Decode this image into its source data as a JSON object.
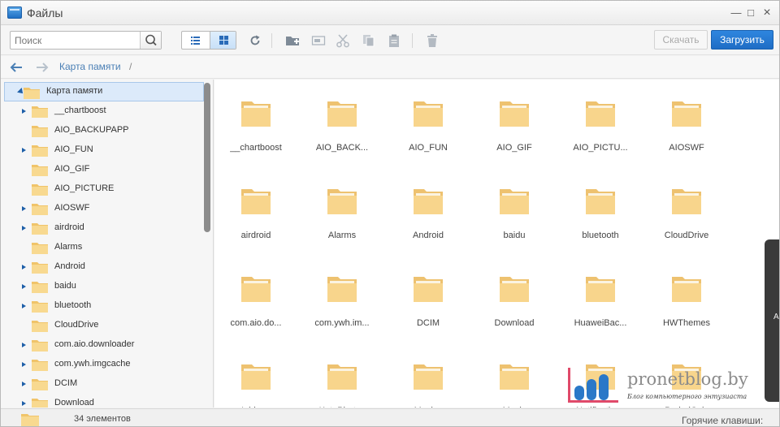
{
  "window": {
    "title": "Файлы",
    "controls": {
      "close": "×",
      "maximize": "□",
      "minimize": "—"
    }
  },
  "toolbar": {
    "search_placeholder": "Поиск",
    "secondary_button": "Скачать",
    "primary_button": "Загрузить",
    "icons": [
      "search-icon",
      "list-view-icon",
      "grid-view-icon",
      "refresh-icon",
      "new-folder-icon",
      "rename-icon",
      "cut-icon",
      "copy-icon",
      "paste-icon",
      "delete-icon"
    ]
  },
  "breadcrumb": {
    "path": "Карта памяти",
    "separator": "/"
  },
  "tree": {
    "root": "Карта памяти",
    "items": [
      {
        "label": "__chartboost",
        "expandable": true
      },
      {
        "label": "AIO_BACKUPAPP",
        "expandable": false
      },
      {
        "label": "AIO_FUN",
        "expandable": true
      },
      {
        "label": "AIO_GIF",
        "expandable": false
      },
      {
        "label": "AIO_PICTURE",
        "expandable": false
      },
      {
        "label": "AIOSWF",
        "expandable": true
      },
      {
        "label": "airdroid",
        "expandable": true
      },
      {
        "label": "Alarms",
        "expandable": false
      },
      {
        "label": "Android",
        "expandable": true
      },
      {
        "label": "baidu",
        "expandable": true
      },
      {
        "label": "bluetooth",
        "expandable": true
      },
      {
        "label": "CloudDrive",
        "expandable": false
      },
      {
        "label": "com.aio.downloader",
        "expandable": true
      },
      {
        "label": "com.ywh.imgcache",
        "expandable": true
      },
      {
        "label": "DCIM",
        "expandable": true
      },
      {
        "label": "Download",
        "expandable": true
      }
    ]
  },
  "grid": {
    "items": [
      "__chartboost",
      "AIO_BACK...",
      "AIO_FUN",
      "AIO_GIF",
      "AIO_PICTU...",
      "AIOSWF",
      "airdroid",
      "Alarms",
      "Android",
      "baidu",
      "bluetooth",
      "CloudDrive",
      "com.aio.do...",
      "com.ywh.im...",
      "DCIM",
      "Download",
      "HuaweiBac...",
      "HWThemes",
      "Iuidoon",
      "KatePhotos",
      "Movies",
      "Music",
      "Notifications",
      "PeriodCalc"
    ]
  },
  "status": {
    "count": "34 элементов",
    "hotkeys": "Горячие клавиши:"
  },
  "watermark": {
    "site": "pronetblog.by",
    "tagline": "Блог компьютерного энтузиаста"
  },
  "colors": {
    "accent": "#1f6dc5",
    "folder": "#f6cf7c",
    "selection": "#dceafa"
  }
}
